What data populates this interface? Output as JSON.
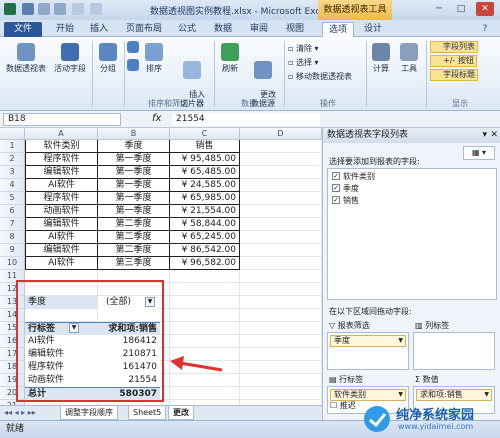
{
  "window": {
    "title": "数据透视图实例教程.xlsx - Microsoft Excel",
    "context_tab": "数据透视表工具"
  },
  "tabs": [
    "文件",
    "开始",
    "插入",
    "页面布局",
    "公式",
    "数据",
    "审阅",
    "视图",
    "选项",
    "设计"
  ],
  "ribbon": {
    "buttons": {
      "pivot_table": "数据透视表",
      "active_field": "活动字段",
      "group": "分组",
      "sort": "排序",
      "insert_slicer": "插入\n切片器",
      "refresh": "刷新",
      "change_source": "更改\n数据源",
      "clear": "清除",
      "select": "选择",
      "move_pivot": "移动数据透视表",
      "calculations": "计算",
      "tools": "工具",
      "field_list": "字段列表",
      "plus_minus": "+/- 按钮",
      "field_headers": "字段标题"
    },
    "groups": {
      "sort_filter": "排序和筛选",
      "data": "数据",
      "actions": "操作",
      "show": "显示"
    }
  },
  "formula_bar": {
    "name_box": "B18",
    "fx": "fx",
    "value": "21554"
  },
  "grid": {
    "columns": [
      "A",
      "B",
      "C",
      "D"
    ],
    "rows": [
      "1",
      "2",
      "3",
      "4",
      "5",
      "6",
      "7",
      "8",
      "9",
      "10",
      "11",
      "12",
      "13",
      "14",
      "15",
      "16",
      "17",
      "18",
      "19",
      "20",
      "21"
    ],
    "table_header": [
      "软件类别",
      "季度",
      "销售"
    ],
    "table_rows": [
      [
        "程序软件",
        "第一季度",
        "¥ 95,485.00"
      ],
      [
        "编辑软件",
        "第一季度",
        "¥ 65,485.00"
      ],
      [
        "AI软件",
        "第一季度",
        "¥ 24,585.00"
      ],
      [
        "程序软件",
        "第一季度",
        "¥ 65,985.00"
      ],
      [
        "动画软件",
        "第一季度",
        "¥ 21,554.00"
      ],
      [
        "编辑软件",
        "第二季度",
        "¥ 58,844.00"
      ],
      [
        "AI软件",
        "第二季度",
        "¥ 65,245.00"
      ],
      [
        "编辑软件",
        "第二季度",
        "¥ 86,542.00"
      ],
      [
        "AI软件",
        "第三季度",
        "¥ 96,582.00"
      ]
    ],
    "pivot": {
      "filter_label": "季度",
      "filter_value": "(全部)",
      "row_label_header": "行标签",
      "value_header": "求和项:销售",
      "rows": [
        [
          "AI软件",
          "186412"
        ],
        [
          "编辑软件",
          "210871"
        ],
        [
          "程序软件",
          "161470"
        ],
        [
          "动画软件",
          "21554"
        ]
      ],
      "total_label": "总计",
      "total_value": "580307"
    }
  },
  "sheet_tabs": [
    "调整字段顺序",
    "Sheet5",
    "更改"
  ],
  "status": "就绪",
  "field_list": {
    "title": "数据透视表字段列表",
    "choose_prompt": "选择要添加到报表的字段:",
    "fields": [
      "软件类别",
      "季度",
      "销售"
    ],
    "drag_prompt": "在以下区域间拖动字段:",
    "areas": {
      "report_filter": "报表筛选",
      "column_labels": "列标签",
      "row_labels": "行标签",
      "values": "数值"
    },
    "pills": {
      "filter": "季度",
      "row": "软件类别",
      "value": "求和项:销售"
    },
    "defer": "推迟"
  },
  "watermark": {
    "name": "纯净系统家园",
    "url": "www.yidaimei.com"
  },
  "colors": {
    "file_tab": "#2b579a",
    "context_tab": "#f0b94c",
    "arrow": "#e03030"
  }
}
